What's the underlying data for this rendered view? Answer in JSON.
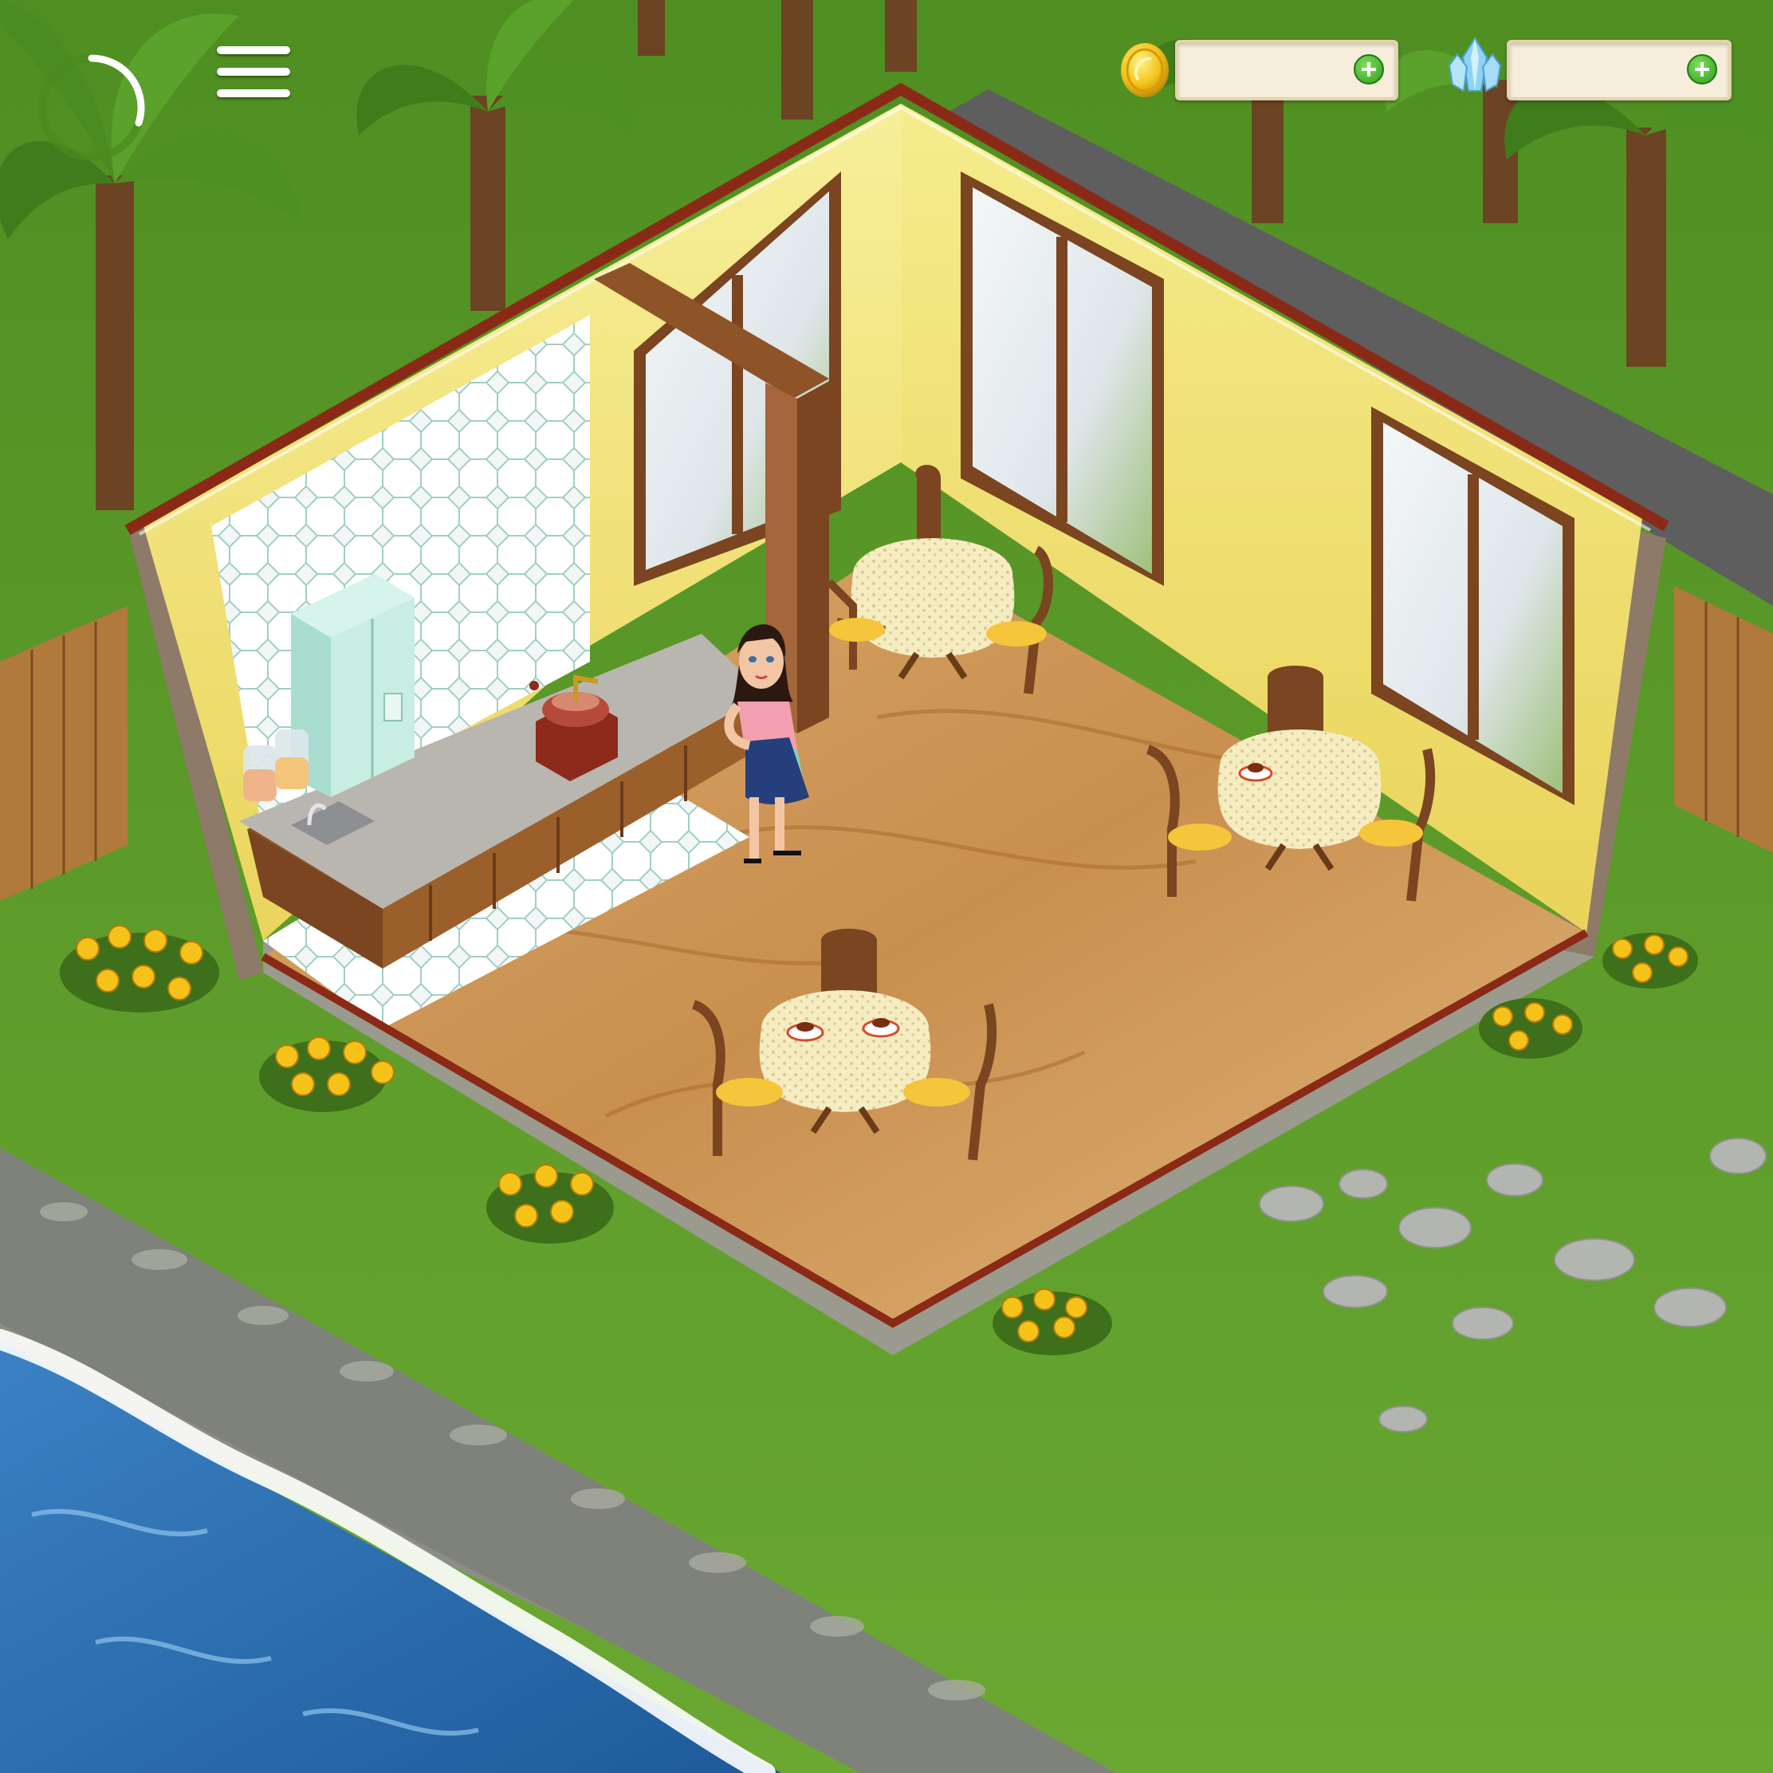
{
  "hud": {
    "menu_icon": "hamburger-menu-icon",
    "progress_icon": "level-progress-ring-icon",
    "progress_fraction": 0.3,
    "coins": {
      "icon": "gold-coin-icon",
      "value": "",
      "add_icon": "plus-icon"
    },
    "gems": {
      "icon": "blue-crystal-icon",
      "value": "",
      "add_icon": "plus-icon"
    }
  },
  "scene": {
    "location": "cafe-room",
    "floor": "wooden-planks",
    "wall_color": "#f4e77a",
    "roof_trim_color": "#8a2a16",
    "grass_color": "#5e9a2a",
    "water_color": "#2f6fb2",
    "objects": [
      "refrigerator",
      "jars",
      "sink",
      "kitchen-counter",
      "coffee-grinder",
      "waitress",
      "table-1",
      "table-2",
      "table-3",
      "flower-bushes",
      "palm-trees",
      "fence",
      "river",
      "stones"
    ]
  }
}
